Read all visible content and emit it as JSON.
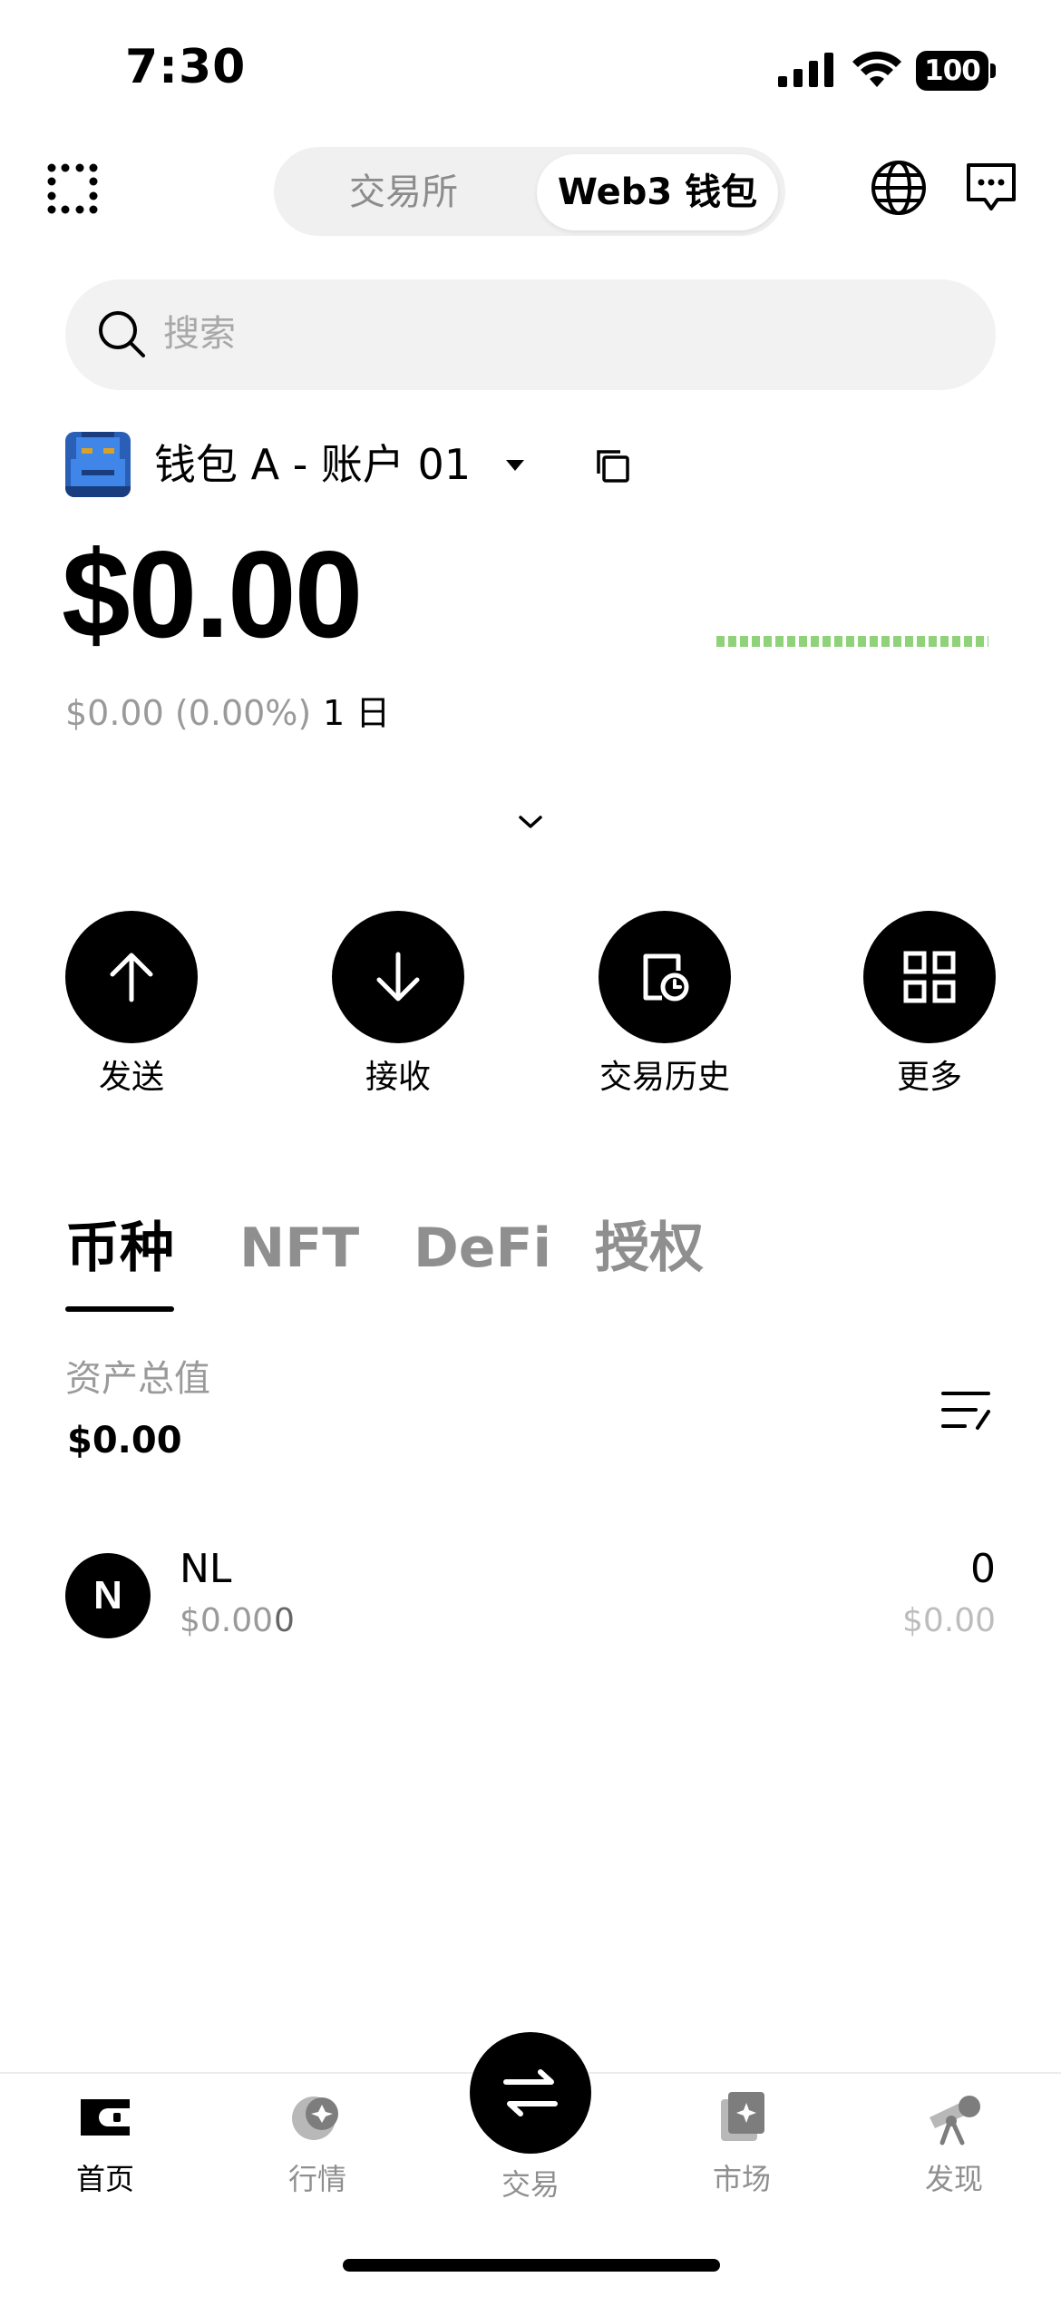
{
  "status_bar": {
    "time": "7:30",
    "battery": "100"
  },
  "header": {
    "tabs": [
      {
        "label": "交易所",
        "active": false
      },
      {
        "label": "Web3 钱包",
        "active": true
      }
    ]
  },
  "search": {
    "placeholder": "搜索"
  },
  "wallet": {
    "name": "钱包 A - 账户 01",
    "balance": "$0.00",
    "change": "$0.00 (0.00%)",
    "period": "1 日"
  },
  "actions": [
    {
      "label": "发送",
      "icon": "arrow-up-icon"
    },
    {
      "label": "接收",
      "icon": "arrow-down-icon"
    },
    {
      "label": "交易历史",
      "icon": "history-icon"
    },
    {
      "label": "更多",
      "icon": "grid-icon"
    }
  ],
  "asset_tabs": [
    {
      "label": "币种",
      "active": true
    },
    {
      "label": "NFT",
      "active": false
    },
    {
      "label": "DeFi",
      "active": false
    },
    {
      "label": "授权",
      "active": false
    }
  ],
  "assets": {
    "total_label": "资产总值",
    "total_value": "$0.00",
    "tokens": [
      {
        "symbol_letter": "N",
        "name": "NL",
        "price": "$0.00",
        "change": "0",
        "quantity": "0",
        "value": "$0.00"
      }
    ]
  },
  "bottom_nav": [
    {
      "label": "首页",
      "icon": "wallet-icon",
      "active": true
    },
    {
      "label": "行情",
      "icon": "market-icon",
      "active": false
    },
    {
      "label": "交易",
      "icon": "swap-icon",
      "active": false
    },
    {
      "label": "市场",
      "icon": "nft-market-icon",
      "active": false
    },
    {
      "label": "发现",
      "icon": "telescope-icon",
      "active": false
    }
  ],
  "colors": {
    "accent": "#000000",
    "sparkline": "#8fd27a",
    "muted_text": "#9a9a9a",
    "surface": "#f2f2f2"
  }
}
